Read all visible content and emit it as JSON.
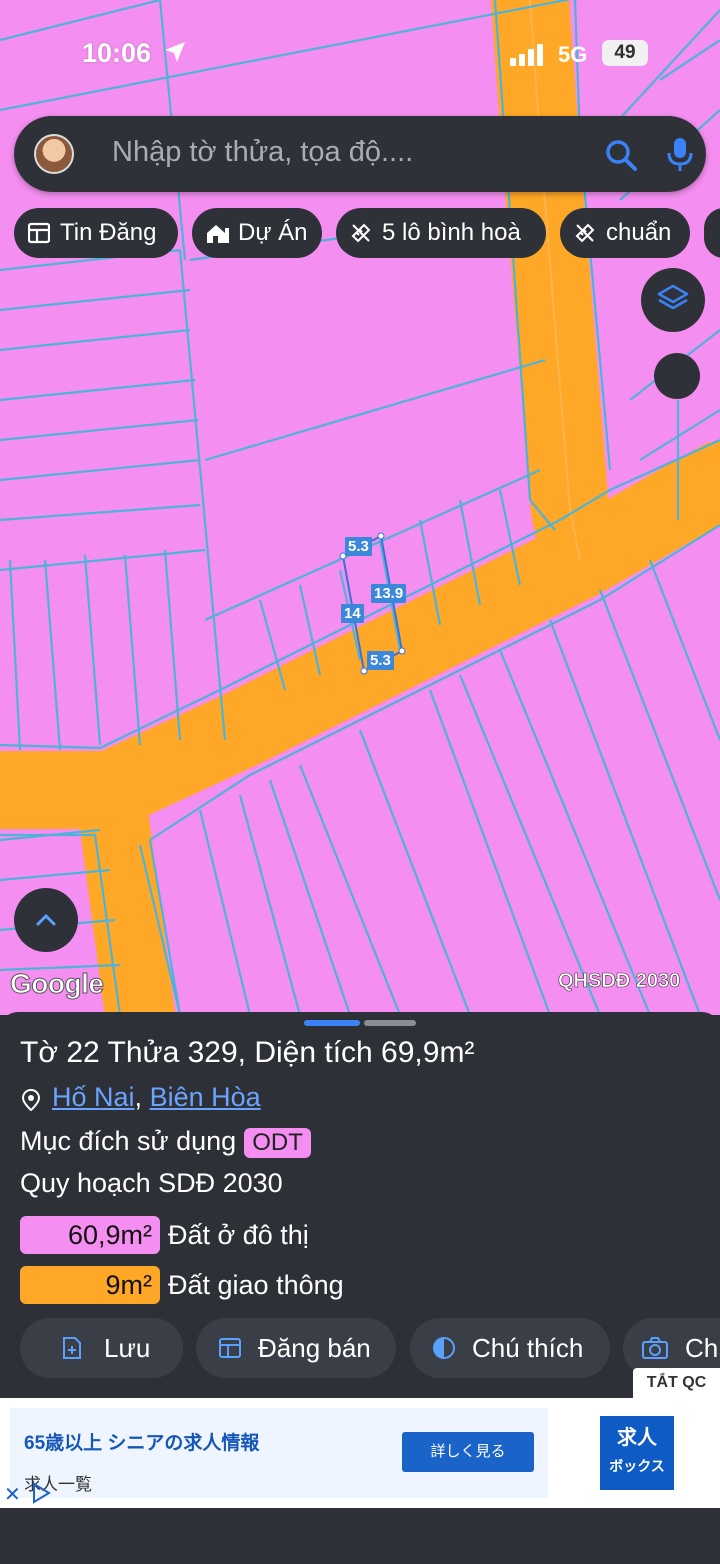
{
  "status": {
    "time": "10:06",
    "network": "5G",
    "battery": "49"
  },
  "search": {
    "placeholder": "Nhập tờ thửa, tọa độ...."
  },
  "chips": [
    {
      "label": "Tin Đăng",
      "icon": "listing-icon"
    },
    {
      "label": "Dự Án",
      "icon": "project-icon"
    },
    {
      "label": "5 lô bình hoà",
      "icon": "ruler-icon"
    },
    {
      "label": "chuẩn",
      "icon": "ruler-icon"
    }
  ],
  "map": {
    "google_label": "Google",
    "layer_label": "QHSDĐ 2030",
    "dimensions": {
      "top": "5.3",
      "right": "13.9",
      "left": "14",
      "bottom": "5.3"
    },
    "colors": {
      "residential": "#f48ef0",
      "road": "#ffa726",
      "parcel_line": "#4fb3d9"
    }
  },
  "parcel": {
    "title": "Tờ 22 Thửa 329, Diện tích 69,9m²",
    "ward": "Hố Nai",
    "separator": ",",
    "city": "Biên Hòa",
    "purpose_label": "Mục đích sử dụng",
    "purpose_code": "ODT",
    "plan_label": "Quy hoạch SDĐ 2030",
    "areas": [
      {
        "value": "60,9m²",
        "label": "Đất ở đô thị",
        "color": "#f48ef0"
      },
      {
        "value": "9m²",
        "label": "Đất giao thông",
        "color": "#ffa726"
      }
    ]
  },
  "actions": [
    {
      "label": "Lưu",
      "icon": "save-icon"
    },
    {
      "label": "Đăng bán",
      "icon": "post-icon"
    },
    {
      "label": "Chú thích",
      "icon": "contrast-icon"
    },
    {
      "label": "Ch",
      "icon": "camera-icon"
    }
  ],
  "ad": {
    "hide_label": "TẮT QC",
    "headline": "65歳以上 シニアの求人情報",
    "sub": "求人一覧",
    "cta": "詳しく見る",
    "logo_line1": "求人",
    "logo_line2": "ボックス",
    "close": "✕"
  }
}
